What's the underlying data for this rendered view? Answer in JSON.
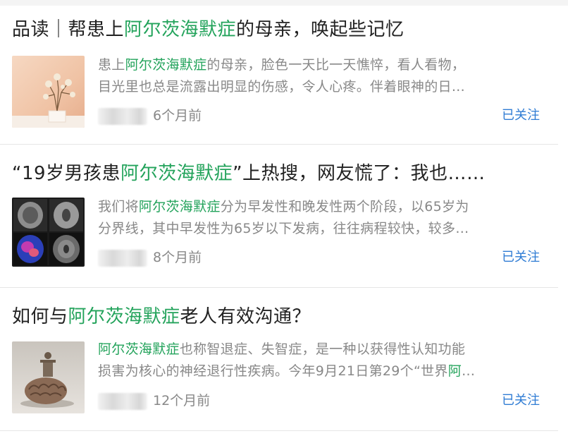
{
  "items": [
    {
      "title_parts": [
        "品读｜帮患上",
        "阿尔茨海默症",
        "的母亲，唤起些记忆"
      ],
      "snippet_line1": [
        "患上",
        "阿尔茨海默症",
        "的母亲，脸色一天比一天憔悴，看人看物，"
      ],
      "snippet_line2": [
        "目光里也总是流露出明显的伤感，令人心疼。伴着眼神的日…"
      ],
      "time": "6个月前",
      "follow": "已关注",
      "thumbnail_icon": "dried-flower-photo"
    },
    {
      "title_parts": [
        "“19岁男孩患",
        "阿尔茨海默症",
        "”上热搜，网友慌了：我也……"
      ],
      "snippet_line1": [
        "我们将",
        "阿尔茨海默症",
        "分为早发性和晚发性两个阶段，以65岁为"
      ],
      "snippet_line2": [
        "分界线，其中早发性为65岁以下发病，往往病程较快，较多…"
      ],
      "time": "8个月前",
      "follow": "已关注",
      "thumbnail_icon": "brain-scan-photo"
    },
    {
      "title_parts": [
        "如何与",
        "阿尔茨海默症",
        "老人有效沟通？"
      ],
      "snippet_line1": [
        "阿尔茨海默症",
        "也称智退症、失智症，是一种以获得性认知功能"
      ],
      "snippet_line2": [
        "损害为核心的神经退行性疾病。今年9月21日第29个“世界",
        "阿",
        "…"
      ],
      "time": "12个月前",
      "follow": "已关注",
      "thumbnail_icon": "brain-sculpture-photo"
    }
  ]
}
